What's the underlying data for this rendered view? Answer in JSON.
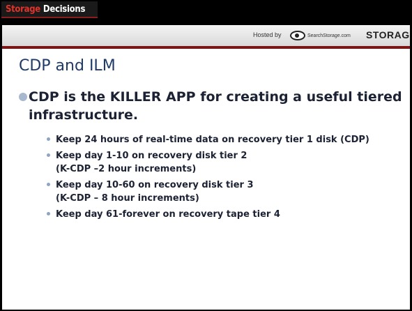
{
  "header": {
    "brand_part1": "Storage",
    "brand_part2": "Decisions",
    "hosted_by": "Hosted by",
    "host_logo_text": "SearchStorage.com",
    "host_logo_brand": "STORAGE"
  },
  "slide": {
    "title": "CDP and ILM",
    "main_bullet": "CDP is the KILLER APP for creating a useful tiered infrastructure.",
    "sub_bullets": [
      "Keep 24 hours of real-time data on recovery tier 1 disk (CDP)",
      "Keep day 1-10 on recovery disk tier 2\n(K-CDP –2 hour increments)",
      "Keep day 10-60 on recovery disk tier 3\n(K-CDP – 8 hour increments)",
      "Keep day 61-forever on recovery tape tier 4"
    ]
  },
  "colors": {
    "frame": "#000000",
    "title": "#1f3a68",
    "accent_rule": "#7a1616",
    "brand_red": "#e0332a",
    "bullet": "#a8b8cf"
  },
  "icons": [
    "bullet-dot-icon",
    "eye-logo-icon"
  ]
}
